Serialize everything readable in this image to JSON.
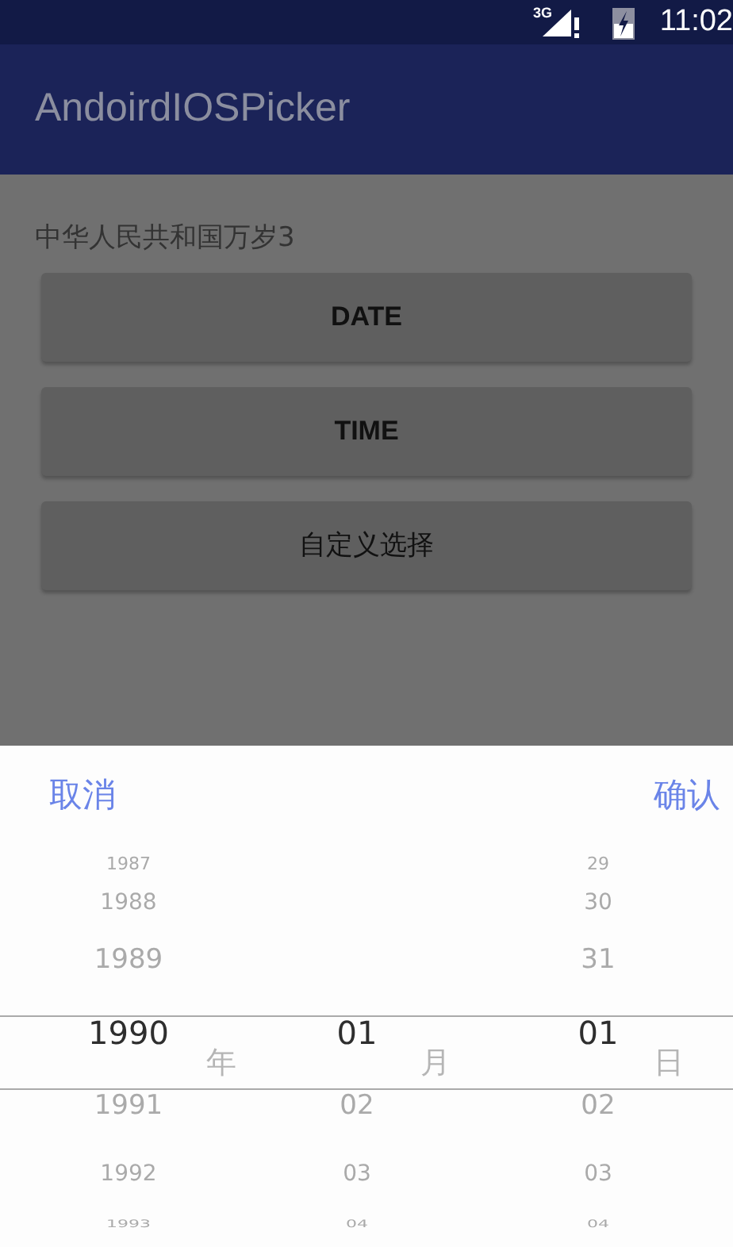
{
  "status_bar": {
    "network": "3G",
    "time": "11:02"
  },
  "app_bar": {
    "title": "AndoirdIOSPicker"
  },
  "content": {
    "label": "中华人民共和国万岁3",
    "buttons": [
      "DATE",
      "TIME",
      "自定义选择"
    ]
  },
  "picker": {
    "cancel": "取消",
    "confirm": "确认",
    "columns": [
      {
        "unit": "年",
        "items": [
          {
            "text": "1987",
            "selected": false
          },
          {
            "text": "1988",
            "selected": false
          },
          {
            "text": "1989",
            "selected": false
          },
          {
            "text": "1990",
            "selected": true
          },
          {
            "text": "1991",
            "selected": false
          },
          {
            "text": "1992",
            "selected": false
          },
          {
            "text": "1993",
            "selected": false
          }
        ]
      },
      {
        "unit": "月",
        "items": [
          {
            "text": "01",
            "selected": true
          },
          {
            "text": "02",
            "selected": false
          },
          {
            "text": "03",
            "selected": false
          },
          {
            "text": "04",
            "selected": false
          }
        ]
      },
      {
        "unit": "日",
        "items": [
          {
            "text": "29",
            "selected": false
          },
          {
            "text": "30",
            "selected": false
          },
          {
            "text": "31",
            "selected": false
          },
          {
            "text": "01",
            "selected": true
          },
          {
            "text": "02",
            "selected": false
          },
          {
            "text": "03",
            "selected": false
          },
          {
            "text": "04",
            "selected": false
          }
        ]
      }
    ]
  }
}
